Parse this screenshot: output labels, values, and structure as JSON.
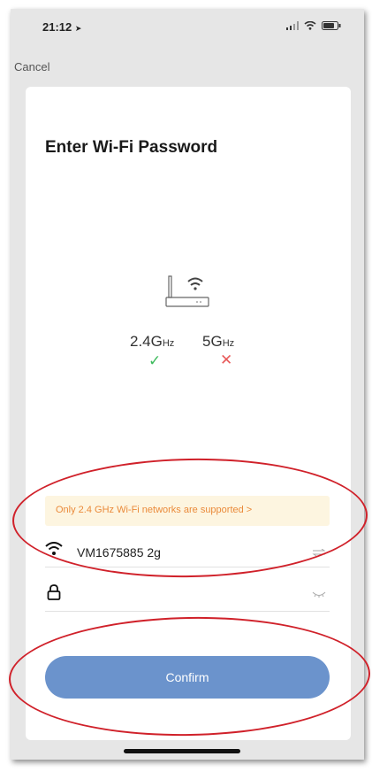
{
  "status_bar": {
    "time": "21:12",
    "location_glyph": "➤"
  },
  "nav": {
    "cancel_label": "Cancel"
  },
  "page": {
    "title": "Enter Wi-Fi Password"
  },
  "bands": {
    "band_24_main": "2.4G",
    "band_24_suffix": "Hz",
    "band_5_main": "5G",
    "band_5_suffix": "Hz",
    "supported_glyph": "✓",
    "unsupported_glyph": "✕"
  },
  "notice": {
    "text": "Only 2.4 GHz Wi-Fi networks are supported >"
  },
  "form": {
    "ssid_value": "VM1675885 2g",
    "password_value": ""
  },
  "actions": {
    "confirm_label": "Confirm"
  },
  "colors": {
    "accent_button": "#6b93cc",
    "notice_text": "#ea8a3a",
    "notice_bg": "#fdf5e0",
    "check_green": "#3dbb5c",
    "cross_red": "#e85a5a",
    "annotation_red": "#d0212a"
  },
  "icons": [
    "location-arrow-icon",
    "signal-icon",
    "wifi-status-icon",
    "battery-icon",
    "router-icon",
    "check-icon",
    "cross-icon",
    "wifi-icon",
    "switch-network-icon",
    "lock-icon",
    "eye-closed-icon"
  ]
}
